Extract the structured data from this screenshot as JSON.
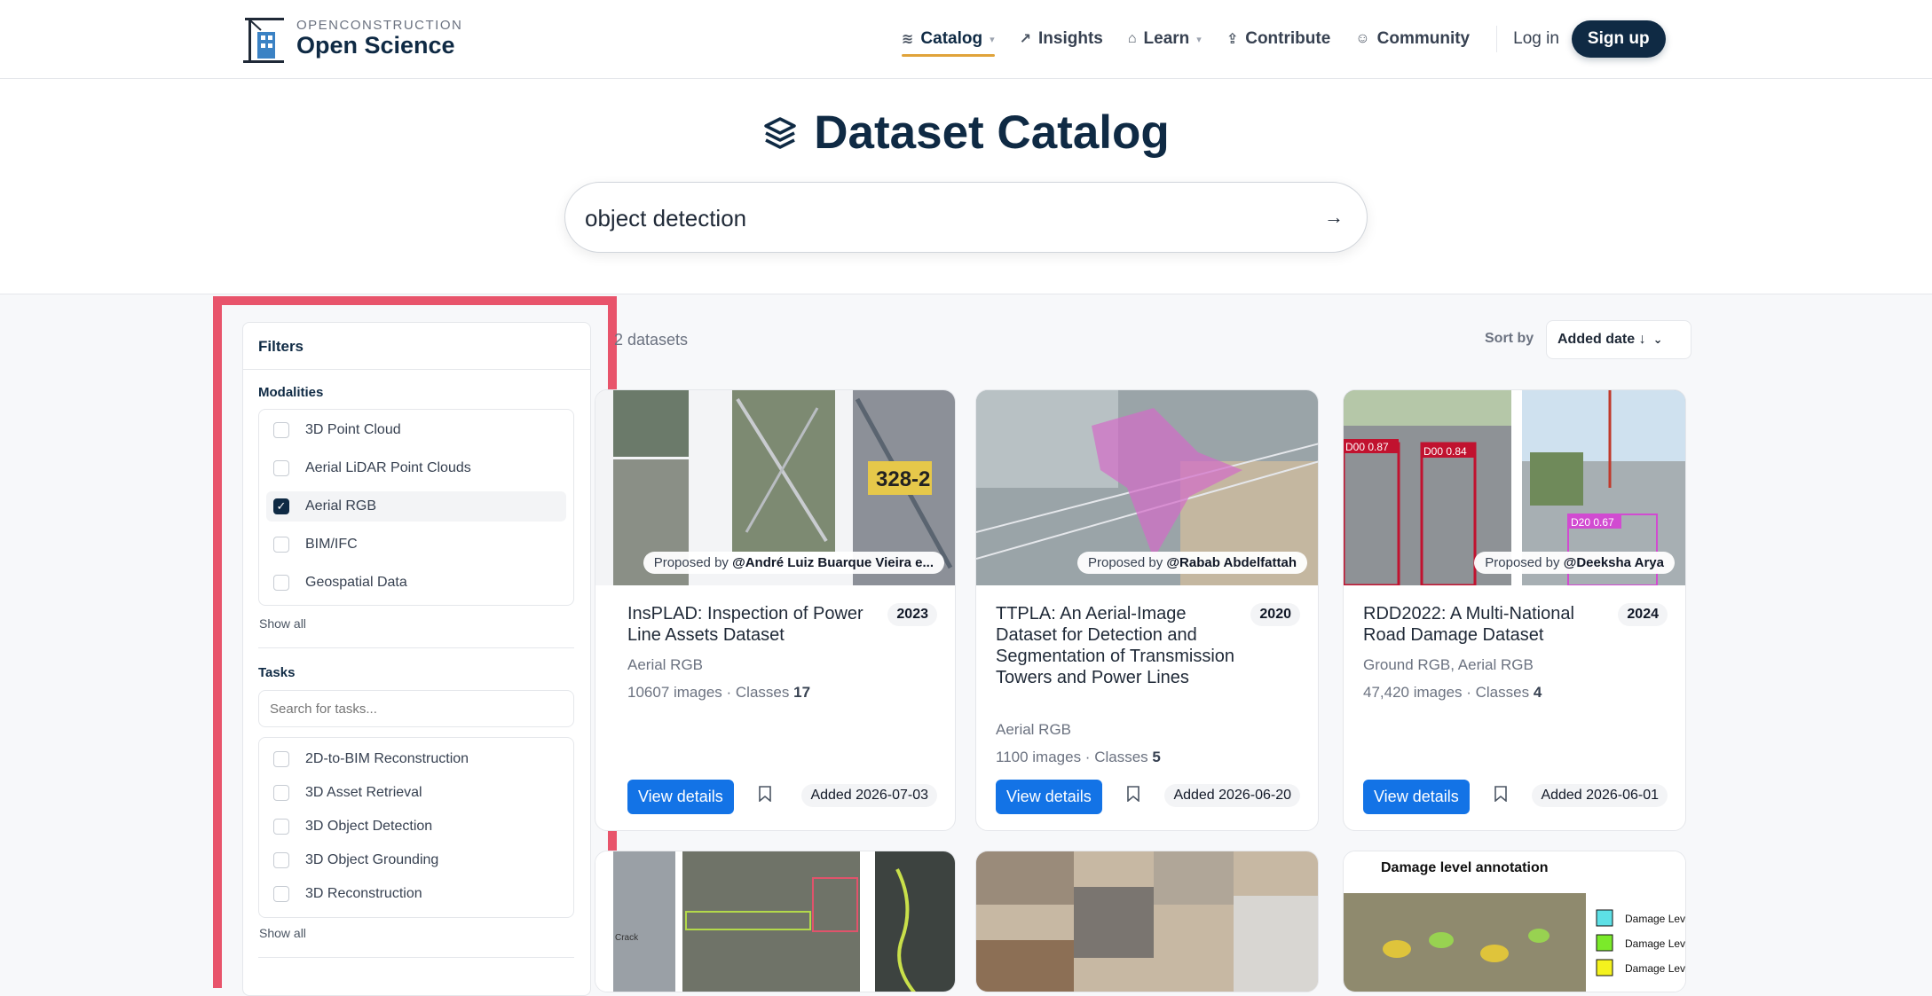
{
  "brand": {
    "small": "OPENCONSTRUCTION",
    "big": "Open Science"
  },
  "nav": {
    "items": [
      {
        "label": "Catalog",
        "icon": "layers-icon"
      },
      {
        "label": "Insights",
        "icon": "chart-icon"
      },
      {
        "label": "Learn",
        "icon": "graduation-cap-icon"
      },
      {
        "label": "Contribute",
        "icon": "upload-icon"
      },
      {
        "label": "Community",
        "icon": "user-icon"
      }
    ],
    "login": "Log in",
    "signup": "Sign up"
  },
  "hero": {
    "title": "Dataset Catalog",
    "search_value": "object detection"
  },
  "filters": {
    "title": "Filters",
    "modalities": {
      "title": "Modalities",
      "options": [
        {
          "label": "3D Point Cloud",
          "checked": false
        },
        {
          "label": "Aerial LiDAR Point Clouds",
          "checked": false
        },
        {
          "label": "Aerial RGB",
          "checked": true
        },
        {
          "label": "BIM/IFC",
          "checked": false
        },
        {
          "label": "Geospatial Data",
          "checked": false
        }
      ],
      "show_all": "Show all"
    },
    "tasks": {
      "title": "Tasks",
      "search_placeholder": "Search for tasks...",
      "options": [
        {
          "label": "2D-to-BIM Reconstruction",
          "checked": false
        },
        {
          "label": "3D Asset Retrieval",
          "checked": false
        },
        {
          "label": "3D Object Detection",
          "checked": false
        },
        {
          "label": "3D Object Grounding",
          "checked": false
        },
        {
          "label": "3D Reconstruction",
          "checked": false
        }
      ],
      "show_all": "Show all"
    }
  },
  "results": {
    "count_text": "2 datasets",
    "sort_label": "Sort by",
    "sort_value": "Added date ↓"
  },
  "cards": [
    {
      "proposer_prefix": "Proposed by",
      "proposer": "@André Luiz Buarque Vieira e...",
      "title": "InsPLAD: Inspection of Power Line Assets Dataset",
      "year": "2023",
      "modalities": "Aerial RGB",
      "images": "10607 images · Classes",
      "classes": "17",
      "view": "View details",
      "added": "Added 2026-07-03",
      "img_label": "328-2"
    },
    {
      "proposer_prefix": "Proposed by",
      "proposer": "@Rabab Abdelfattah",
      "title": "TTPLA: An Aerial-Image Dataset for Detection and Segmentation of Transmission Towers and Power Lines",
      "year": "2020",
      "modalities": "Aerial RGB",
      "images": "1100 images · Classes",
      "classes": "5",
      "view": "View details",
      "added": "Added 2026-06-20"
    },
    {
      "proposer_prefix": "Proposed by",
      "proposer": "@Deeksha Arya",
      "title": "RDD2022: A Multi-National Road Damage Dataset",
      "year": "2024",
      "modalities": "Ground RGB, Aerial RGB",
      "images": "47,420 images · Classes",
      "classes": "4",
      "view": "View details",
      "added": "Added 2026-06-01",
      "img_tags": [
        "D00 0.87",
        "D00 0.84",
        "D20 0.67"
      ]
    }
  ],
  "row2": {
    "crack_label": "Crack",
    "annotation_title": "Damage level annotation",
    "legend": [
      "Damage Leve",
      "Damage Leve",
      "Damage Leve"
    ]
  },
  "colors": {
    "brand_navy": "#0f2a44",
    "accent_blue": "#1373e6",
    "highlight": "#e8546b"
  }
}
